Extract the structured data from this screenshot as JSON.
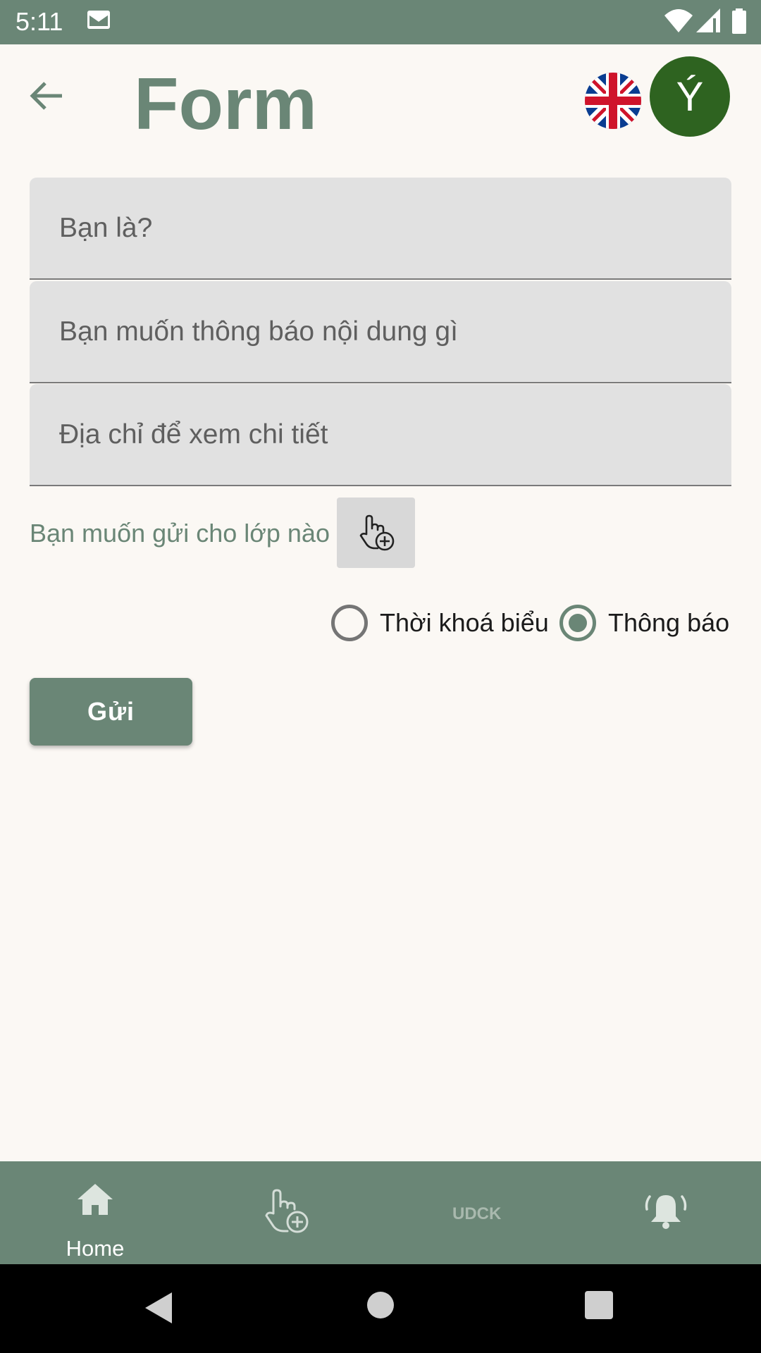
{
  "status_bar": {
    "time": "5:11",
    "icons": [
      "mail-icon",
      "wifi-icon",
      "signal-icon",
      "battery-icon"
    ]
  },
  "header": {
    "title": "Form",
    "back_icon": "arrow-left-icon",
    "language_icon": "uk-flag-icon",
    "avatar_letter": "Ý",
    "avatar_color": "#2e6320"
  },
  "form": {
    "fields": [
      {
        "placeholder": "Bạn là?"
      },
      {
        "placeholder": "Bạn muốn thông báo nội dung gì"
      },
      {
        "placeholder": "Địa chỉ để xem chi tiết"
      }
    ],
    "class_label": "Bạn muốn gửi cho lớp nào",
    "class_button_icon": "hand-pointer-plus-icon",
    "radio_options": [
      {
        "label": "Thời khoá biểu",
        "checked": false
      },
      {
        "label": "Thông báo",
        "checked": true
      }
    ],
    "submit_label": "Gửi"
  },
  "bottom_nav": {
    "items": [
      {
        "icon": "home-icon",
        "label": "Home"
      },
      {
        "icon": "hand-pointer-plus-icon",
        "label": ""
      },
      {
        "icon": "udck-logo-icon",
        "logo_text": "UDCK",
        "label": ""
      },
      {
        "icon": "bell-ringing-icon",
        "label": ""
      }
    ]
  },
  "colors": {
    "primary": "#6a8676",
    "background": "#fbf8f4",
    "field_background": "#e1e1e1"
  }
}
